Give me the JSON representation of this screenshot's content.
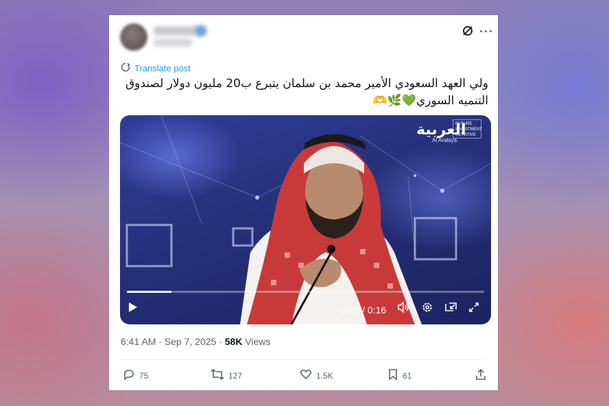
{
  "post": {
    "translate_label": "Translate post",
    "text_line1": "ولي  العهد  السعودي الأمير محمد بن سلمان يتبرع ب20  مليون دولار لصندوق",
    "text_line2": "التنميه السوري💚🌿🫶",
    "timestamp": "6:41 AM · Sep 7, 2025 · ",
    "views_count": "58K",
    "views_label": " Views"
  },
  "video": {
    "channel_logo": "العربية",
    "channel_sub": "Al Arabiya",
    "overlay_badge": "FUTURE INVESTMENT INITIATIVE",
    "time": "0:02 / 0:16",
    "progress_fraction": 0.125
  },
  "actions": {
    "replies": "75",
    "reposts": "127",
    "likes": "1.5K",
    "bookmarks": "61"
  },
  "icons": {
    "more": "more-icon",
    "grok": "grok-icon",
    "translate": "translate-icon",
    "reply": "reply-icon",
    "repost": "repost-icon",
    "like": "heart-icon",
    "bookmark": "bookmark-icon",
    "share": "share-icon"
  },
  "colors": {
    "link": "#1d9bf0",
    "muted": "#536471",
    "text": "#0f1419"
  }
}
